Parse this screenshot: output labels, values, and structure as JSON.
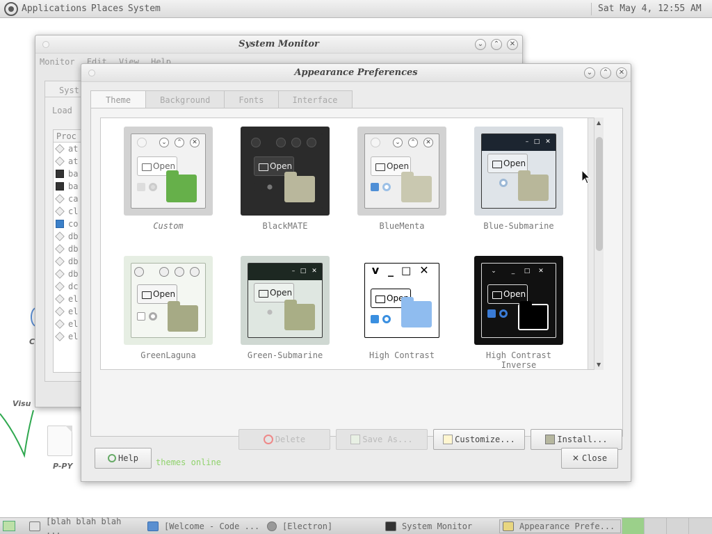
{
  "top_panel": {
    "menus": [
      "Applications",
      "Places",
      "System"
    ],
    "clock": "Sat May  4, 12:55 AM"
  },
  "desktop": {
    "icon_label": "P-PY",
    "label_visu": "Visu",
    "label_c": "C"
  },
  "system_monitor": {
    "title": "System Monitor",
    "menu": [
      "Monitor",
      "Edit",
      "View",
      "Help"
    ],
    "tab": "Syst",
    "load": "Load",
    "list_header": "Proc",
    "rows": [
      {
        "label": "at",
        "icon": "gear"
      },
      {
        "label": "at",
        "icon": "gear"
      },
      {
        "label": "ba",
        "icon": "terminal"
      },
      {
        "label": "ba",
        "icon": "terminal"
      },
      {
        "label": "ca",
        "icon": "gear"
      },
      {
        "label": "cl",
        "icon": "gear"
      },
      {
        "label": "co",
        "icon": "code"
      },
      {
        "label": "db",
        "icon": "gear"
      },
      {
        "label": "db",
        "icon": "gear"
      },
      {
        "label": "db",
        "icon": "gear"
      },
      {
        "label": "db",
        "icon": "gear"
      },
      {
        "label": "dc",
        "icon": "gear"
      },
      {
        "label": "el",
        "icon": "gear"
      },
      {
        "label": "el",
        "icon": "gear"
      },
      {
        "label": "el",
        "icon": "gear"
      },
      {
        "label": "el",
        "icon": "gear"
      }
    ]
  },
  "appearance": {
    "title": "Appearance Preferences",
    "tabs": [
      "Theme",
      "Background",
      "Fonts",
      "Interface"
    ],
    "themes": [
      {
        "name": "Custom"
      },
      {
        "name": "BlackMATE"
      },
      {
        "name": "BlueMenta"
      },
      {
        "name": "Blue-Submarine"
      },
      {
        "name": "GreenLaguna"
      },
      {
        "name": "Green-Submarine"
      },
      {
        "name": "High Contrast"
      },
      {
        "name": "High Contrast Inverse"
      }
    ],
    "open_label": "Open",
    "buttons": {
      "delete": "Delete",
      "save_as": "Save As...",
      "customize": "Customize...",
      "install": "Install..."
    },
    "link": "Get more themes online",
    "help": "Help",
    "close": "Close"
  },
  "taskbar": {
    "tasks": [
      {
        "label": "[blah blah blah ..."
      },
      {
        "label": "[Welcome - Code ..."
      },
      {
        "label": "[Electron]"
      },
      {
        "label": "System Monitor"
      },
      {
        "label": "Appearance Prefe..."
      }
    ]
  }
}
